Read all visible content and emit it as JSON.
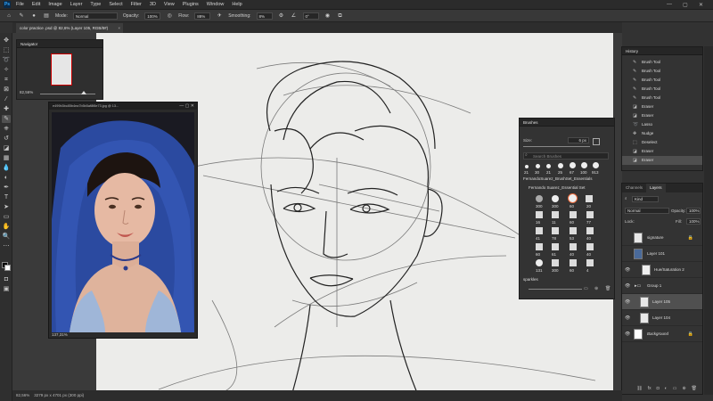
{
  "app": {
    "logo": "Ps"
  },
  "menu": [
    "File",
    "Edit",
    "Image",
    "Layer",
    "Type",
    "Select",
    "Filter",
    "3D",
    "View",
    "Plugins",
    "Window",
    "Help"
  ],
  "options": {
    "mode_label": "Mode:",
    "mode_value": "Normal",
    "opacity_label": "Opacity:",
    "opacity_value": "100%",
    "flow_label": "Flow:",
    "flow_value": "88%",
    "smoothing_label": "Smoothing:",
    "smoothing_value": "8%",
    "angle_value": "0°"
  },
  "document": {
    "tab_title": "color practice .psd @ 82,6% (Layer 105, RGB/8#)"
  },
  "navigator": {
    "title": "Navigator",
    "zoom": "82,56%"
  },
  "reference": {
    "title": "e499b3bc85b4ea7b5b5af8f8e73.jpg @ 13...",
    "zoom": "137,31%"
  },
  "status": {
    "zoom": "82,56%",
    "doc_size": "3279 px x 4701 px (300 ppi)"
  },
  "brushes": {
    "title": "Brushes",
    "size_label": "Size:",
    "size_value": "6 px",
    "search_placeholder": "Search Brushes",
    "preset_sizes": [
      "21",
      "30",
      "21",
      "25",
      "67",
      "100",
      "913"
    ],
    "folder1": "Fernando&uuml;brez_BrushSet_Essentials",
    "folder1_display": "FernandoSuarez_BrushSet_Essentials",
    "folder2": "Fernando Suarez_Essential Set",
    "grid_labels": [
      "300",
      "300",
      "60",
      "20",
      "16",
      "11",
      "60",
      "77",
      "41",
      "78",
      "53",
      "40",
      "60",
      "61",
      "40",
      "40",
      "131",
      "300",
      "60",
      "4"
    ],
    "folder3": "sparkles"
  },
  "history": {
    "title": "History",
    "items": [
      "Brush Tool",
      "Brush Tool",
      "Brush Tool",
      "Brush Tool",
      "Brush Tool",
      "Eraser",
      "Eraser",
      "Lasso",
      "Nudge",
      "Deselect",
      "Eraser",
      "Eraser"
    ]
  },
  "layers": {
    "tabs": [
      "Channels",
      "Layers"
    ],
    "kind_label": "Kind",
    "blend_mode": "Normal",
    "opacity_label": "Opacity:",
    "opacity_value": "100%",
    "lock_label": "Lock:",
    "fill_label": "Fill:",
    "fill_value": "100%",
    "items": [
      "signature",
      "Layer 101",
      "Hue/Saturation 2",
      "Group 1",
      "Layer 105",
      "Layer 104",
      "Background"
    ]
  }
}
